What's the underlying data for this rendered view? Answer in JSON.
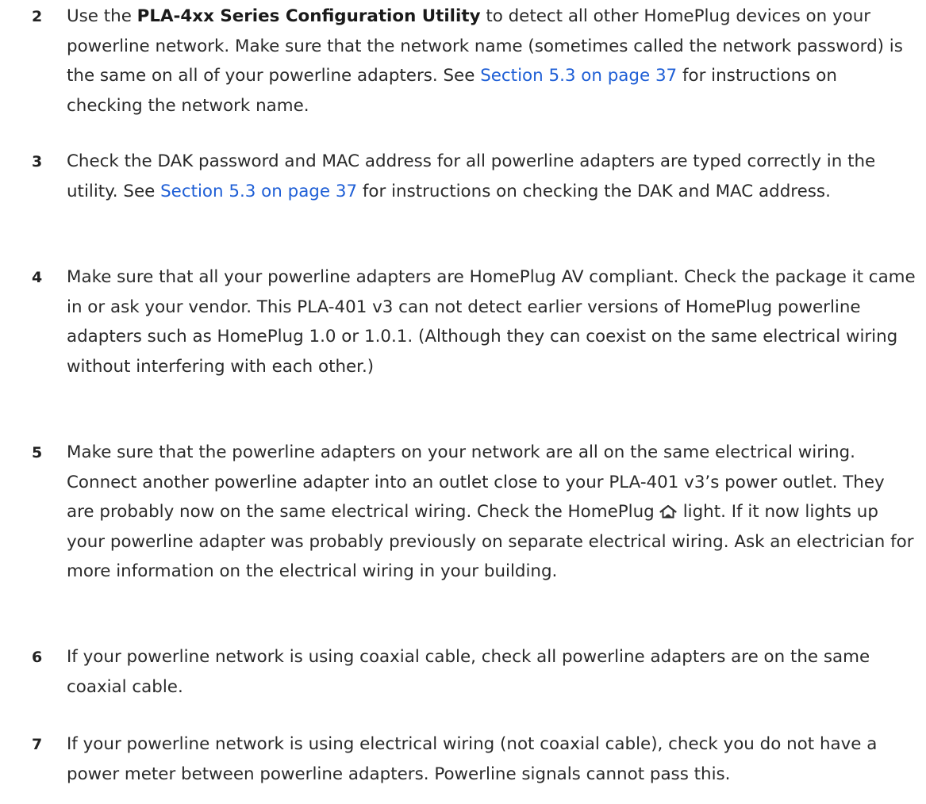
{
  "steps": [
    {
      "number": "2",
      "parts": {
        "a": "Use the ",
        "b_bold": "PLA-4xx Series Configuration Utility",
        "c": " to detect all other HomePlug devices on your powerline network. Make sure that the network name (sometimes called the network password) is the same on all of your powerline adapters. See ",
        "d_link": "Section 5.3 on page 37",
        "e": " for instructions on checking the network name."
      }
    },
    {
      "number": "3",
      "parts": {
        "a": "Check the DAK password and MAC address for all powerline adapters are typed correctly in the utility. See ",
        "b_link": "Section 5.3 on page 37",
        "c": " for instructions on checking the DAK and MAC address."
      }
    },
    {
      "number": "4",
      "text": "Make sure that all your powerline adapters are HomePlug AV compliant. Check the package it came in or ask your vendor. This PLA-401 v3 can not detect earlier versions of HomePlug powerline adapters such as HomePlug 1.0 or 1.0.1. (Although they can coexist on the same electrical wiring without interfering with each other.)"
    },
    {
      "number": "5",
      "parts": {
        "a": "Make sure that the powerline adapters on your network are all on the same electrical wiring. Connect another powerline adapter into an outlet close to your PLA-401 v3’s power outlet. They are probably now on the same electrical wiring. Check the HomePlug",
        "icon": "homeplug-house-icon",
        "b": "light. If it now lights up your powerline adapter was probably previously on separate electrical wiring. Ask an electrician for more information on the electrical wiring in your building."
      }
    },
    {
      "number": "6",
      "text": "If your powerline network is using coaxial cable, check all powerline adapters are on the same coaxial cable."
    },
    {
      "number": "7",
      "text": "If your powerline network is using electrical wiring (not coaxial cable), check you do not have a power meter between powerline adapters. Powerline signals cannot pass this."
    }
  ],
  "colors": {
    "text": "#2a2a2a",
    "link": "#1f5fd6",
    "background": "#ffffff"
  }
}
